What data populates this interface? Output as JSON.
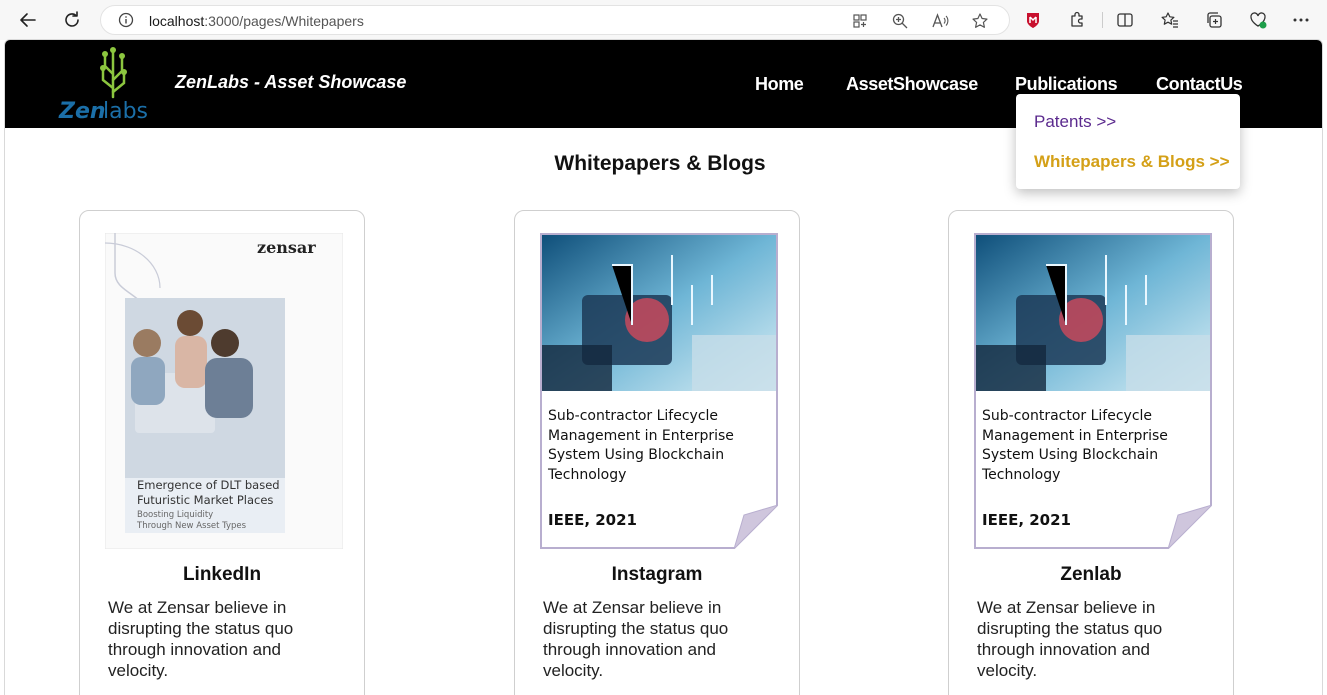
{
  "browser": {
    "url_host": "localhost",
    "url_path": ":3000/pages/Whitepapers"
  },
  "header": {
    "title": "ZenLabs - Asset Showcase",
    "logo_text": "Zenlabs",
    "nav": [
      {
        "label": "Home"
      },
      {
        "label": "AssetShowcase"
      },
      {
        "label": "Publications"
      },
      {
        "label": "ContactUs"
      }
    ]
  },
  "dropdown": {
    "items": [
      {
        "label": "Patents >>"
      },
      {
        "label": "Whitepapers & Blogs >>"
      }
    ]
  },
  "section": {
    "heading": "Whitepapers & Blogs"
  },
  "cards": [
    {
      "title": "LinkedIn",
      "description": "We at Zensar believe in disrupting the status quo through innovation and velocity.",
      "cover": {
        "brand": "zensar",
        "headline": "Emergence of DLT based Futuristic Market Places",
        "subline": "Boosting Liquidity Through New Asset Types"
      }
    },
    {
      "title": "Instagram",
      "description": "We at Zensar believe in disrupting the status quo through innovation and velocity.",
      "cover": {
        "paper_title": "Sub-contractor Lifecycle Management in Enterprise System Using Blockchain Technology",
        "venue": "IEEE, 2021"
      }
    },
    {
      "title": "Zenlab",
      "description": "We at Zensar believe in disrupting the status quo through innovation and velocity.",
      "cover": {
        "paper_title": "Sub-contractor Lifecycle Management in Enterprise System Using Blockchain Technology",
        "venue": "IEEE, 2021"
      }
    }
  ],
  "colors": {
    "header_bg": "#000000",
    "dropdown_active": "#d4a017",
    "dropdown_link": "#5b2a8e",
    "logo_green": "#8cc63f",
    "logo_blue": "#1b6fa8"
  },
  "icons": [
    "back-icon",
    "refresh-icon",
    "info-icon",
    "grid-icon",
    "zoom-icon",
    "read-aloud-icon",
    "star-icon",
    "shield-icon",
    "extensions-icon",
    "split-screen-icon",
    "favorites-icon",
    "collections-icon",
    "health-icon",
    "more-icon"
  ]
}
